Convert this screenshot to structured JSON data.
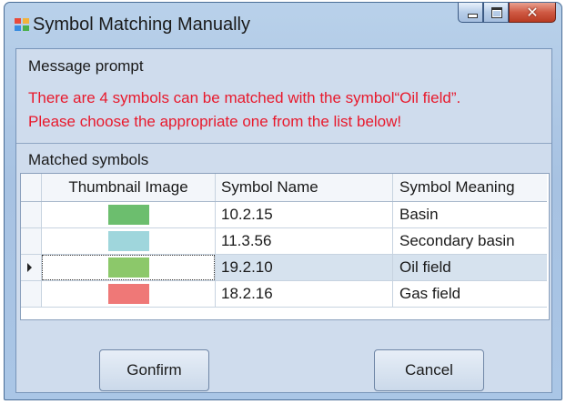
{
  "window": {
    "title": "Symbol Matching Manually",
    "icon": "app-window-icon",
    "controls": {
      "minimize": "minimize-icon",
      "maximize": "maximize-icon",
      "close": "✕"
    }
  },
  "message_group": {
    "title": "Message prompt",
    "lines": [
      "There are 4 symbols can be matched with the symbol“Oil field”.",
      "Please choose the appropriate one from the list below!"
    ],
    "text_color": "#e8192c"
  },
  "matched_group": {
    "title": "Matched symbols",
    "columns": [
      "Thumbnail Image",
      "Symbol Name",
      "Symbol Meaning"
    ],
    "rows": [
      {
        "thumbnail_color": "#6cbe6e",
        "name": "10.2.15",
        "meaning": "Basin"
      },
      {
        "thumbnail_color": "#9fd6dc",
        "name": "11.3.56",
        "meaning": "Secondary basin"
      },
      {
        "thumbnail_color": "#8cc86a",
        "name": "19.2.10",
        "meaning": "Oil field"
      },
      {
        "thumbnail_color": "#ef7877",
        "name": "18.2.16",
        "meaning": "Gas field"
      }
    ],
    "selected_row": 3
  },
  "buttons": {
    "confirm": "Gonfirm",
    "cancel": "Cancel"
  }
}
